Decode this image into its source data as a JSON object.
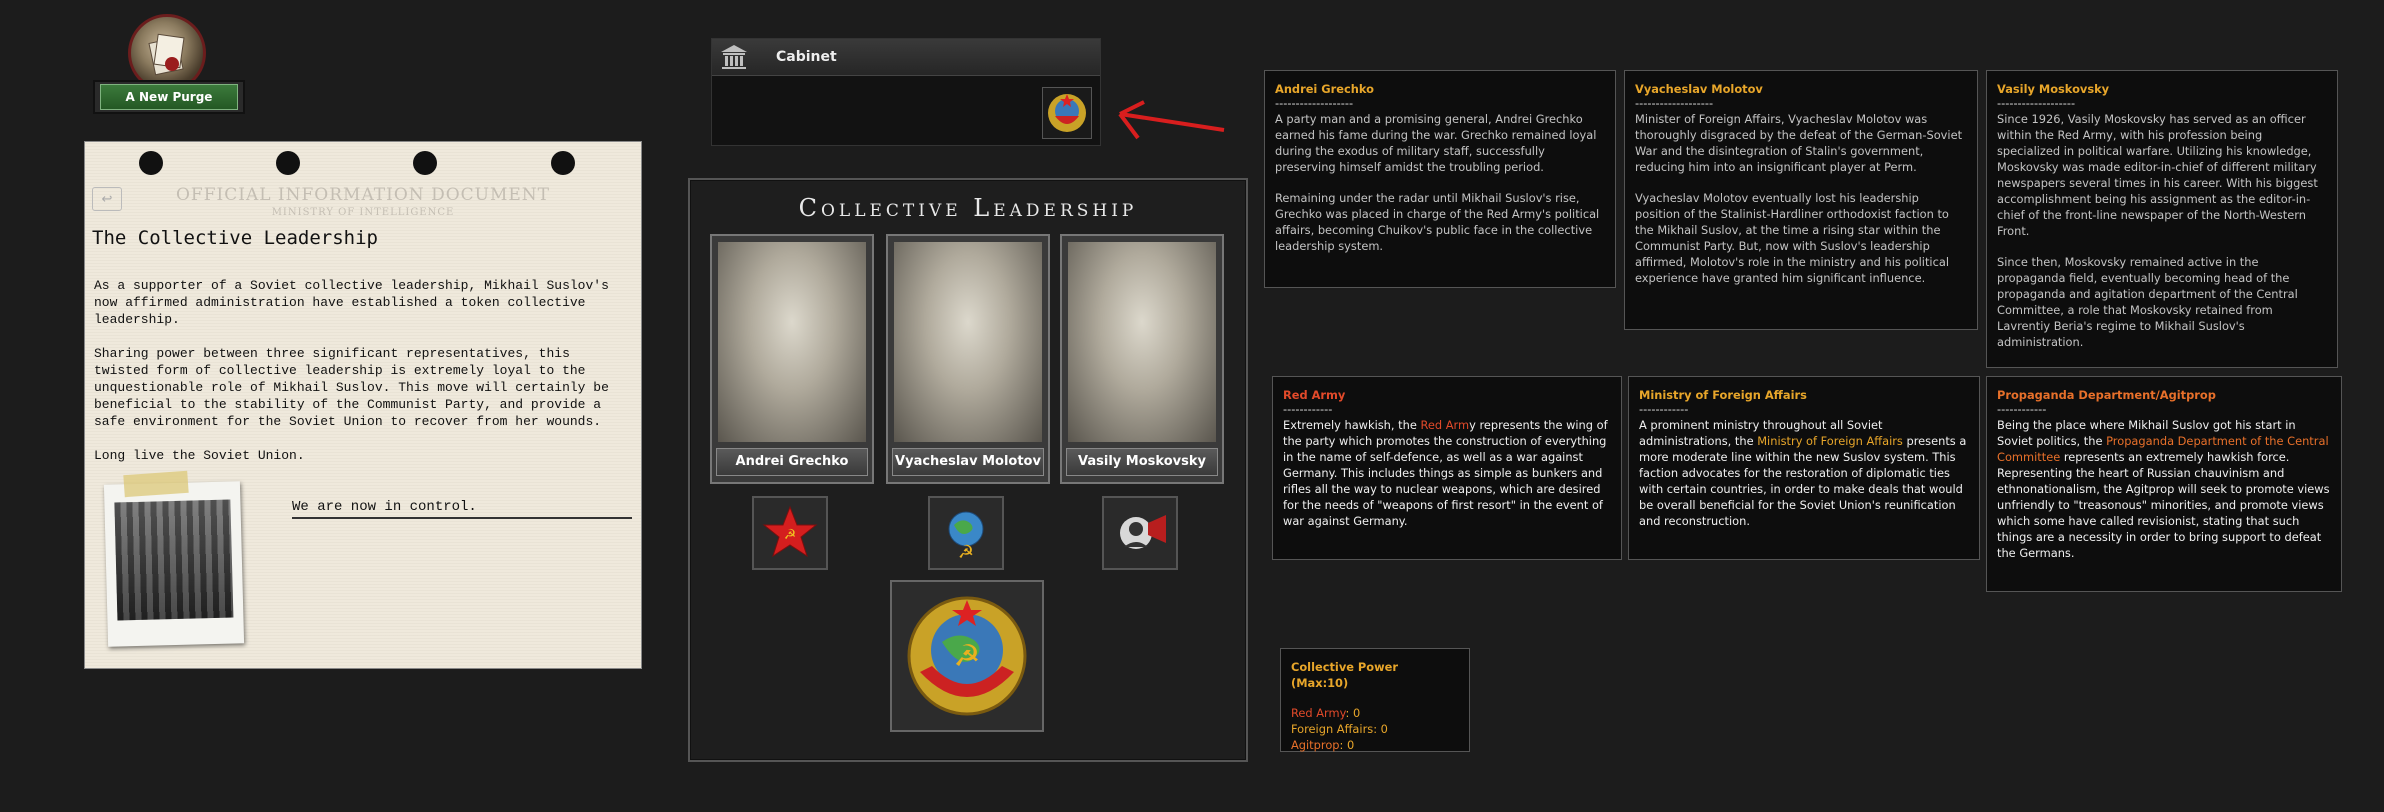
{
  "focus": {
    "label": "A New Purge",
    "icon": "purge-focus-icon"
  },
  "document": {
    "header": "OFFICIAL INFORMATION DOCUMENT",
    "subheader": "MINISTRY OF INTELLIGENCE",
    "title": "The Collective Leadership",
    "paragraphs": [
      "As a supporter of a Soviet collective leadership, Mikhail Suslov's now affirmed administration have established a token collective leadership.",
      "Sharing power between three significant representatives, this twisted form of collective leadership is extremely loyal to the unquestionable role of Mikhail Suslov. This move will certainly be beneficial to the stability of the Communist Party, and provide a safe environment for the Soviet Union to recover from her wounds.",
      "Long live the Soviet Union."
    ],
    "signoff": "We are now in control."
  },
  "cabinet": {
    "title": "Cabinet"
  },
  "panel": {
    "title": "Collective Leadership",
    "portraits": [
      {
        "name": "Andrei Grechko"
      },
      {
        "name": "Vyacheslav Molotov"
      },
      {
        "name": "Vasily Moskovsky"
      }
    ]
  },
  "bios": [
    {
      "name": "Andrei Grechko",
      "dash": "-------------------",
      "p1": "A party man and a promising general, Andrei Grechko earned his fame during the war. Grechko remained loyal during the exodus of military staff, successfully preserving himself amidst the troubling period.",
      "p2": "Remaining under the radar until Mikhail Suslov's rise, Grechko was placed in charge of the Red Army's political affairs, becoming Chuikov's public face in the collective leadership system."
    },
    {
      "name": "Vyacheslav Molotov",
      "dash": "-------------------",
      "p1": "Minister of Foreign Affairs, Vyacheslav Molotov was thoroughly disgraced by the defeat of the German-Soviet War and the disintegration of Stalin's government, reducing him into an insignificant player at Perm.",
      "p2": "Vyacheslav Molotov eventually lost his leadership position of the Stalinist-Hardliner orthodoxist faction to the Mikhail Suslov, at the time a rising star within the Communist Party. But, now with Suslov's leadership affirmed, Molotov's role in the ministry and his political experience have granted him significant influence."
    },
    {
      "name": "Vasily Moskovsky",
      "dash": "-------------------",
      "p1": "Since 1926, Vasily Moskovsky has served as an officer within the Red Army, with his profession being specialized in political warfare. Utilizing his knowledge, Moskovsky was made editor-in-chief of different military newspapers several times in his career. With his biggest accomplishment being his assignment as the editor-in-chief of the front-line newspaper of the North-Western Front.",
      "p2": "Since then, Moskovsky remained active in the propaganda field, eventually becoming head of the propaganda and agitation department of the Central Committee, a role that Moskovsky retained from Lavrentiy Beria's regime to Mikhail Suslov's administration."
    }
  ],
  "factions": [
    {
      "name": "Red Army",
      "dash": "------------",
      "pre": "Extremely hawkish, the ",
      "hl": "Red Arm",
      "post": "y represents the wing of the party which promotes the construction of everything in the name of self-defence, as well as a war against Germany. This includes things as simple as bunkers and rifles all the way to nuclear weapons, which are desired for the needs of \"weapons of first resort\" in the event of war against Germany."
    },
    {
      "name": "Ministry of Foreign Affairs",
      "dash": "------------",
      "pre": "A prominent ministry throughout all Soviet administrations, the ",
      "hl": "Ministry of Foreign Affairs",
      "post": " presents a more moderate line within the new Suslov system. This faction advocates for the restoration of diplomatic ties with certain countries, in order to make deals that would be overall beneficial for the Soviet Union's reunification and reconstruction."
    },
    {
      "name": "Propaganda Department/Agitprop",
      "dash": "------------",
      "pre": "Being the place where Mikhail Suslov got his start in Soviet politics, the ",
      "hl": "Propaganda Department of the Central Committee",
      "post": " represents an extremely hawkish force. Representing the heart of Russian chauvinism and ethnonationalism, the Agitprop will seek to promote views unfriendly to \"treasonous\" minorities, and promote views which some have called revisionist, stating that such things are a necessity in order to bring support to defeat the Germans."
    }
  ],
  "power": {
    "title": "Collective Power (Max:10)",
    "items": [
      {
        "label": "Red Army",
        "value": ": 0"
      },
      {
        "label": "Foreign Affairs",
        "value": ": 0"
      },
      {
        "label": "Agitprop",
        "value": ": 0"
      }
    ]
  },
  "colors": {
    "gold": "#e8a62a",
    "red": "#e24a2a",
    "focus_green": "#3c7a3c",
    "arrow": "#d81e1e"
  }
}
